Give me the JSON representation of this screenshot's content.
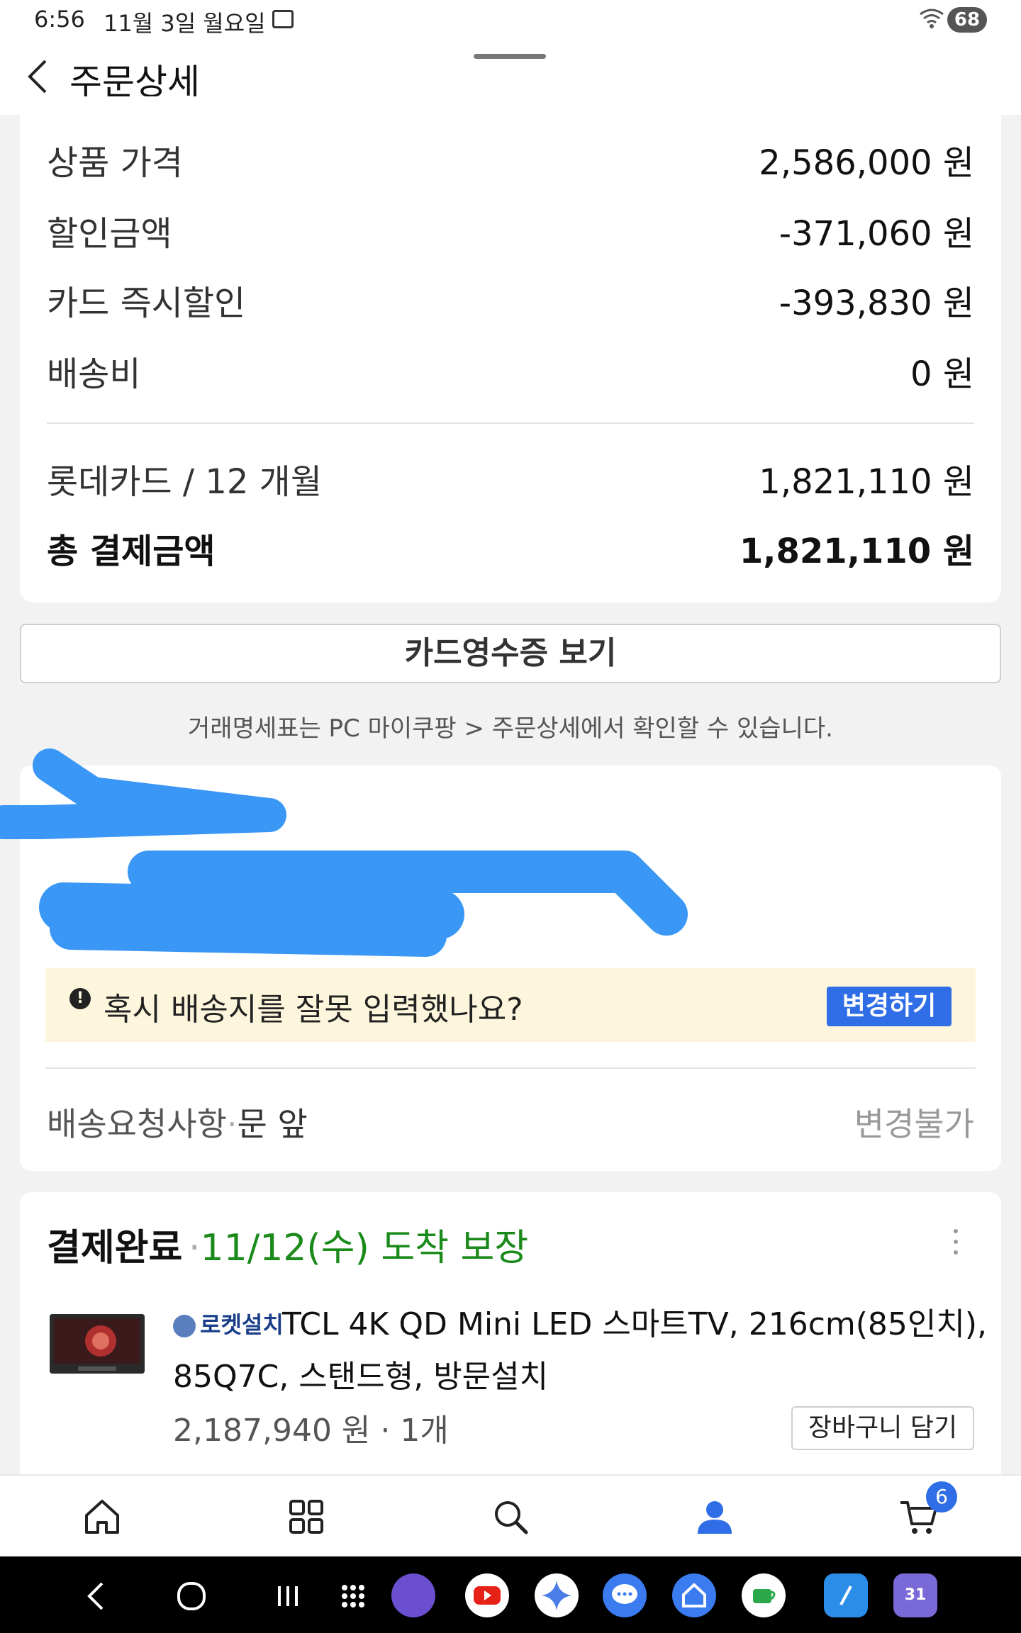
{
  "status_bar": {
    "time": "6:56",
    "date": "11월 3일 월요일",
    "battery": "68"
  },
  "header": {
    "title": "주문상세"
  },
  "payment": {
    "rows": [
      {
        "label": "상품 가격",
        "value": "2,586,000 원"
      },
      {
        "label": "할인금액",
        "value": "-371,060 원"
      },
      {
        "label": "카드 즉시할인",
        "value": "-393,830 원"
      },
      {
        "label": "배송비",
        "value": "0 원"
      }
    ],
    "card_row": {
      "label": "롯데카드 / 12 개월",
      "value": "1,821,110 원"
    },
    "total_row": {
      "label": "총 결제금액",
      "value": "1,821,110 원"
    }
  },
  "receipt": {
    "button_label": "카드영수증 보기",
    "note": "거래명세표는 PC 마이쿠팡 > 주문상세에서 확인할 수 있습니다."
  },
  "address": {
    "warning_text": "혹시 배송지를 잘못 입력했나요?",
    "change_label": "변경하기",
    "request_label": "배송요청사항",
    "request_separator": "·",
    "request_value": "문 앞",
    "request_status": "변경불가"
  },
  "order": {
    "status": "결제완료",
    "separator": "·",
    "arrival": "11/12(수) 도착 보장",
    "badge": "로켓설치",
    "product_line1": "TCL 4K QD Mini LED 스마트TV, 216cm(85인치),",
    "product_line2": "85Q7C, 스탠드형, 방문설치",
    "price": "2,187,940 원 · 1개",
    "cart_button": "장바구니 담기"
  },
  "bottom_nav": {
    "cart_count": "6",
    "active_color": "#2f6ee6"
  },
  "system_nav": {
    "calendar_day": "31"
  },
  "colors": {
    "accent": "#2f6ee6",
    "arrival_green": "#1a8a1a",
    "warning_bg": "#fdf6dd",
    "redaction": "#3b97f5"
  }
}
